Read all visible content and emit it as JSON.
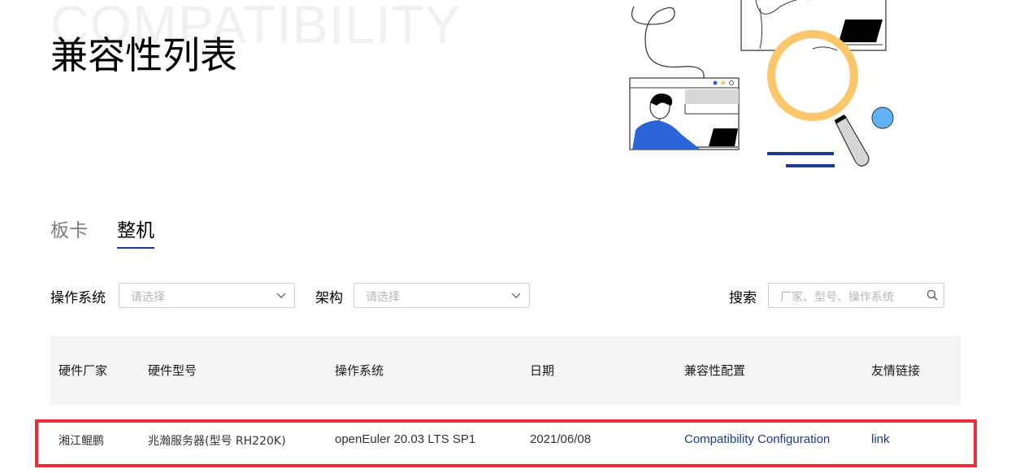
{
  "header": {
    "bg_word": "COMPATIBILITY",
    "title": "兼容性列表"
  },
  "tabs": [
    {
      "label": "板卡",
      "active": false
    },
    {
      "label": "整机",
      "active": true
    }
  ],
  "filters": {
    "os": {
      "label": "操作系统",
      "placeholder": "请选择"
    },
    "arch": {
      "label": "架构",
      "placeholder": "请选择"
    },
    "search": {
      "label": "搜索",
      "placeholder": "厂家、型号、操作系统"
    }
  },
  "table": {
    "columns": [
      "硬件厂家",
      "硬件型号",
      "操作系统",
      "日期",
      "兼容性配置",
      "友情链接"
    ],
    "rows": [
      [
        "湘江鲲鹏",
        "兆瀚服务器(型号 RH220K)",
        "openEuler 20.03 LTS SP1",
        "2021/06/08",
        "Compatibility Configuration",
        "link"
      ]
    ]
  },
  "colors": {
    "accent": "#1d3a8c",
    "highlight": "#e8303a",
    "illus_yellow": "#fcc66a",
    "illus_blue": "#2b66d9",
    "illus_light_blue": "#5fb3f5"
  }
}
